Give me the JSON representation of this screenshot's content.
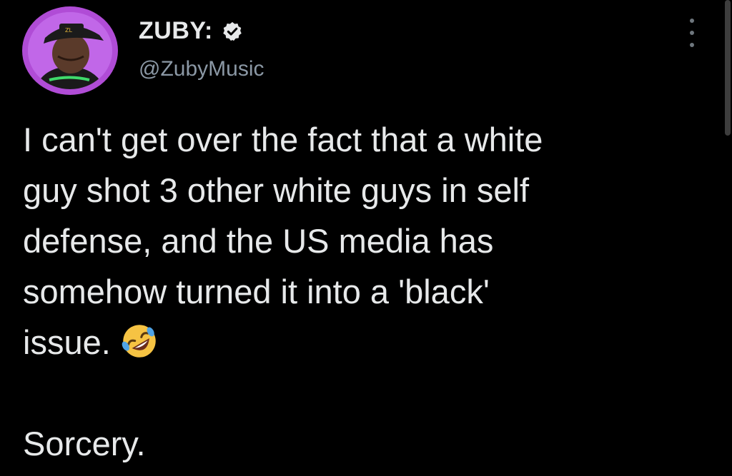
{
  "user": {
    "display_name": "ZUBY:",
    "handle": "@ZubyMusic",
    "verified": true,
    "avatar_ring_color": "#b04cd6"
  },
  "tweet": {
    "lines": [
      "I can't get over the fact that a white",
      "guy shot 3 other white guys in self",
      "defense, and the US media has",
      "somehow turned it into a 'black'",
      "issue."
    ],
    "emoji": "rolling-on-floor-laughing-emoji",
    "closing": "Sorcery."
  },
  "menu": {
    "icon": "more-vertical-icon"
  },
  "colors": {
    "background": "#000000",
    "text": "#e7e9ea",
    "secondary_text": "#8b98a5"
  }
}
